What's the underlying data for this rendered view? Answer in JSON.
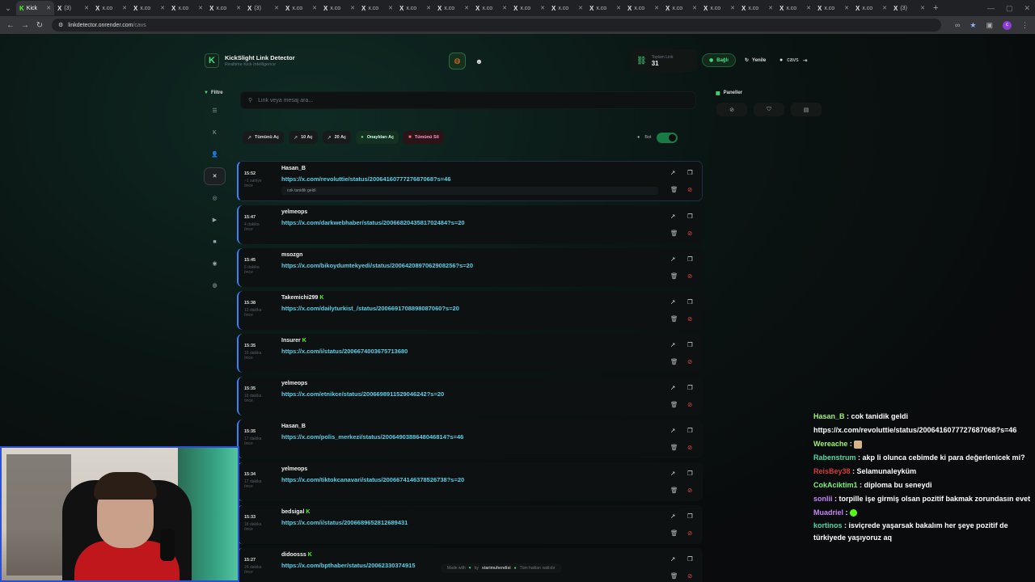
{
  "browser": {
    "tabs": [
      {
        "label": "Kick",
        "fav": "K",
        "active": true
      },
      {
        "label": "(3) ",
        "fav": "X"
      },
      {
        "label": "x.co",
        "fav": "X"
      },
      {
        "label": "x.co",
        "fav": "X"
      },
      {
        "label": "x.co",
        "fav": "X"
      },
      {
        "label": "x.co",
        "fav": "X"
      },
      {
        "label": "(3) ",
        "fav": "X"
      },
      {
        "label": "x.co",
        "fav": "X"
      },
      {
        "label": "x.co",
        "fav": "X"
      },
      {
        "label": "x.co",
        "fav": "X"
      },
      {
        "label": "x.co",
        "fav": "X"
      },
      {
        "label": "x.co",
        "fav": "X"
      },
      {
        "label": "x.co",
        "fav": "X"
      },
      {
        "label": "x.co",
        "fav": "X"
      },
      {
        "label": "x.co",
        "fav": "X"
      },
      {
        "label": "x.co",
        "fav": "X"
      },
      {
        "label": "x.co",
        "fav": "X"
      },
      {
        "label": "x.co",
        "fav": "X"
      },
      {
        "label": "x.co",
        "fav": "X"
      },
      {
        "label": "x.co",
        "fav": "X"
      },
      {
        "label": "x.co",
        "fav": "X"
      },
      {
        "label": "x.co",
        "fav": "X"
      },
      {
        "label": "x.co",
        "fav": "X"
      },
      {
        "label": "(3) ",
        "fav": "X"
      }
    ],
    "url_host": "linkdetector.onrender.com",
    "url_path": "/cavs"
  },
  "app": {
    "title": "KickSlight Link Detector",
    "subtitle": "Realtime Kick Intelligence",
    "stat_label": "Toplam Link",
    "stat_value": "31",
    "status_label": "Bağlı",
    "refresh_label": "Yenile",
    "username": "cavs",
    "filter_label": "Filtre",
    "panels_label": "Paneller",
    "search_placeholder": "Link veya mesaj ara...",
    "bot_label": "Bot",
    "accent": "#4ade80",
    "link_color": "#5ad0e8"
  },
  "actions": [
    {
      "label": "Tümünü Aç",
      "style": "default",
      "icon": "↗"
    },
    {
      "label": "10 Aç",
      "style": "default",
      "icon": "↗"
    },
    {
      "label": "20 Aç",
      "style": "default",
      "icon": "↗"
    },
    {
      "label": "Onaylıları Aç",
      "style": "green",
      "icon": "●"
    },
    {
      "label": "Tümünü Sil",
      "style": "red",
      "icon": "■"
    }
  ],
  "sidebar_icons": [
    "list-icon",
    "kick-icon",
    "users-icon",
    "x-icon",
    "instagram-icon",
    "youtube-icon",
    "video-icon",
    "camera-icon",
    "globe-icon"
  ],
  "links": [
    {
      "time": "15:52",
      "ago": "~1 saniye önce",
      "user": "Hasan_B",
      "kick": false,
      "url": "https://x.com/revoluttie/status/2006416077727687068?s=46",
      "msg": "cok tanidik geldi"
    },
    {
      "time": "15:47",
      "ago": "4 dakika önce",
      "user": "yelmeops",
      "kick": false,
      "url": "https://x.com/darkwebhaber/status/2006682043581702484?s=20",
      "msg": ""
    },
    {
      "time": "15:45",
      "ago": "6 dakika önce",
      "user": "msozgn",
      "kick": false,
      "url": "https://x.com/bikoydumtekyedi/status/2006420897062908256?s=20",
      "msg": ""
    },
    {
      "time": "15:38",
      "ago": "13 dakika önce",
      "user": "Takemichi299",
      "kick": true,
      "url": "https://x.com/dailyturkist_/status/2006691708898087060?s=20",
      "msg": ""
    },
    {
      "time": "15:35",
      "ago": "16 dakika önce",
      "user": "Insurer",
      "kick": true,
      "url": "https://x.com/i/status/2006674003675713680",
      "msg": ""
    },
    {
      "time": "15:35",
      "ago": "16 dakika önce",
      "user": "yelmeops",
      "kick": false,
      "url": "https://x.com/etnikce/status/2006698911529046242?s=20",
      "msg": ""
    },
    {
      "time": "15:35",
      "ago": "17 dakika önce",
      "user": "Hasan_B",
      "kick": false,
      "url": "https://x.com/polis_merkezi/status/2006490388648046814?s=46",
      "msg": ""
    },
    {
      "time": "15:34",
      "ago": "17 dakika önce",
      "user": "yelmeops",
      "kick": false,
      "url": "https://x.com/tiktokcanavari/status/2006674146378526738?s=20",
      "msg": ""
    },
    {
      "time": "15:33",
      "ago": "18 dakika önce",
      "user": "bedsigal",
      "kick": true,
      "url": "https://x.com/i/status/2006689652812689431",
      "msg": ""
    },
    {
      "time": "15:27",
      "ago": "24 dakika önce",
      "user": "didoosss",
      "kick": true,
      "url": "https://x.com/bpthaber/status/20062330374915",
      "msg": ""
    }
  ],
  "footer": {
    "made_with": "Made with",
    "by": "by",
    "author": "starimuhendisi",
    "rights": "Tüm hakları saklıdır"
  },
  "chat": [
    {
      "user": "Hasan_B",
      "color": "#9ef56b",
      "msg": "cok tanidik geldi"
    },
    {
      "user": "",
      "color": "#ffffff",
      "msg": "https://x.com/revoluttie/status/2006416077727687068?s=46"
    },
    {
      "user": "Wereache",
      "color": "#9ef56b",
      "msg": "",
      "emote": "face"
    },
    {
      "user": "Rabenstrum",
      "color": "#4dd9a6",
      "msg": "akp li olunca cebimde ki para değerlenicek mi?"
    },
    {
      "user": "ReisBey38",
      "color": "#d63a3a",
      "msg": "Selamunaleyküm"
    },
    {
      "user": "CokAciktim1",
      "color": "#7df07b",
      "msg": "diploma bu seneydi"
    },
    {
      "user": "sonlii",
      "color": "#c586f7",
      "msg": "torpille işe girmiş olsan pozitif bakmak zorundasın evet"
    },
    {
      "user": "Muadriel",
      "color": "#c586f7",
      "msg": "",
      "emote": "blob"
    },
    {
      "user": "kortinos",
      "color": "#4dd9a6",
      "msg": "isviçrede yaşarsak bakalım her şeye pozitif de türkiyede yaşıyoruz aq"
    }
  ]
}
